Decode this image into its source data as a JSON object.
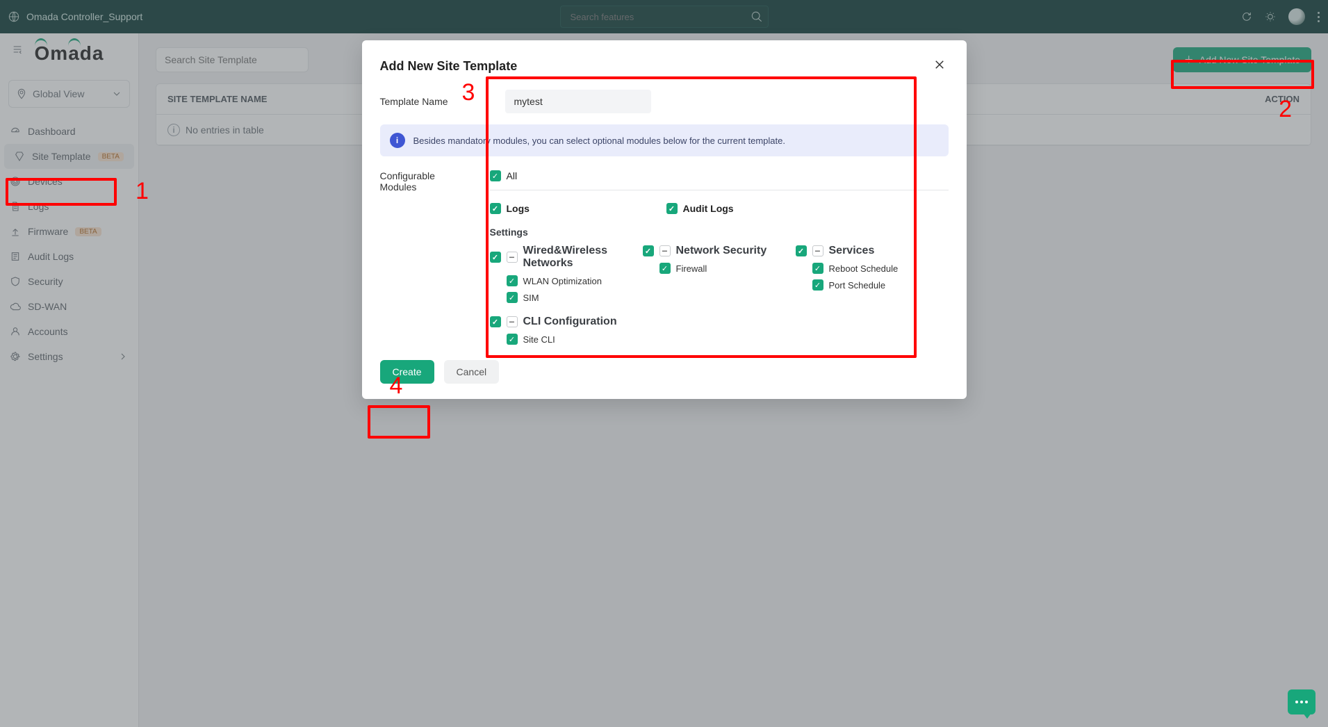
{
  "topbar": {
    "title": "Omada Controller_Support",
    "search_placeholder": "Search features"
  },
  "brand": {
    "text": "Omada"
  },
  "global_view": {
    "label": "Global View"
  },
  "sidebar": {
    "items": [
      {
        "label": "Dashboard"
      },
      {
        "label": "Site Template",
        "badge": "BETA"
      },
      {
        "label": "Devices"
      },
      {
        "label": "Logs"
      },
      {
        "label": "Firmware",
        "badge": "BETA"
      },
      {
        "label": "Audit Logs"
      },
      {
        "label": "Security"
      },
      {
        "label": "SD-WAN"
      },
      {
        "label": "Accounts"
      },
      {
        "label": "Settings"
      }
    ]
  },
  "content": {
    "search_placeholder": "Search Site Template",
    "add_btn": "Add New Site Template",
    "columns": [
      "SITE TEMPLATE NAME",
      "ACTION"
    ],
    "empty_msg": "No entries in table"
  },
  "modal": {
    "title": "Add New Site Template",
    "template_name_label": "Template Name",
    "template_name_value": "mytest",
    "info_text": "Besides mandatory modules, you can select optional modules below for the current template.",
    "config_label": "Configurable Modules",
    "all": "All",
    "logs": "Logs",
    "audit_logs": "Audit Logs",
    "settings": "Settings",
    "groups": {
      "wired": {
        "label": "Wired&Wireless Networks",
        "items": [
          "WLAN Optimization",
          "SIM"
        ]
      },
      "netsec": {
        "label": "Network Security",
        "items": [
          "Firewall"
        ]
      },
      "services": {
        "label": "Services",
        "items": [
          "Reboot Schedule",
          "Port Schedule"
        ]
      },
      "cli": {
        "label": "CLI Configuration",
        "items": [
          "Site CLI"
        ]
      }
    },
    "create": "Create",
    "cancel": "Cancel"
  },
  "annotations": {
    "n1": "1",
    "n2": "2",
    "n3": "3",
    "n4": "4"
  }
}
